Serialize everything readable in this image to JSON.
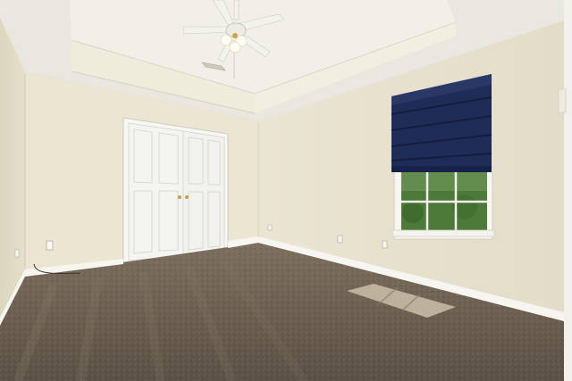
{
  "scene": {
    "kind": "photo",
    "subject": "empty-bedroom",
    "elements": [
      "tray-ceiling",
      "ceiling-fan",
      "air-vent",
      "double-closet-doors",
      "roman-shade",
      "window",
      "carpet",
      "baseboards",
      "outlets",
      "sunlight-patch"
    ]
  },
  "colors": {
    "ceiling": "#ebe9e2",
    "tray": "#f3f1ea",
    "wall_left": "#e6e0cc",
    "wall_back": "#ece6d4",
    "wall_right": "#e9e3d1",
    "trim": "#f6f5f0",
    "door": "#f4f4f1",
    "shade": "#1d2a54",
    "glass": "#4f7a3c",
    "carpet_dark": "#5f5447",
    "carpet_light": "#8a7c6b"
  }
}
